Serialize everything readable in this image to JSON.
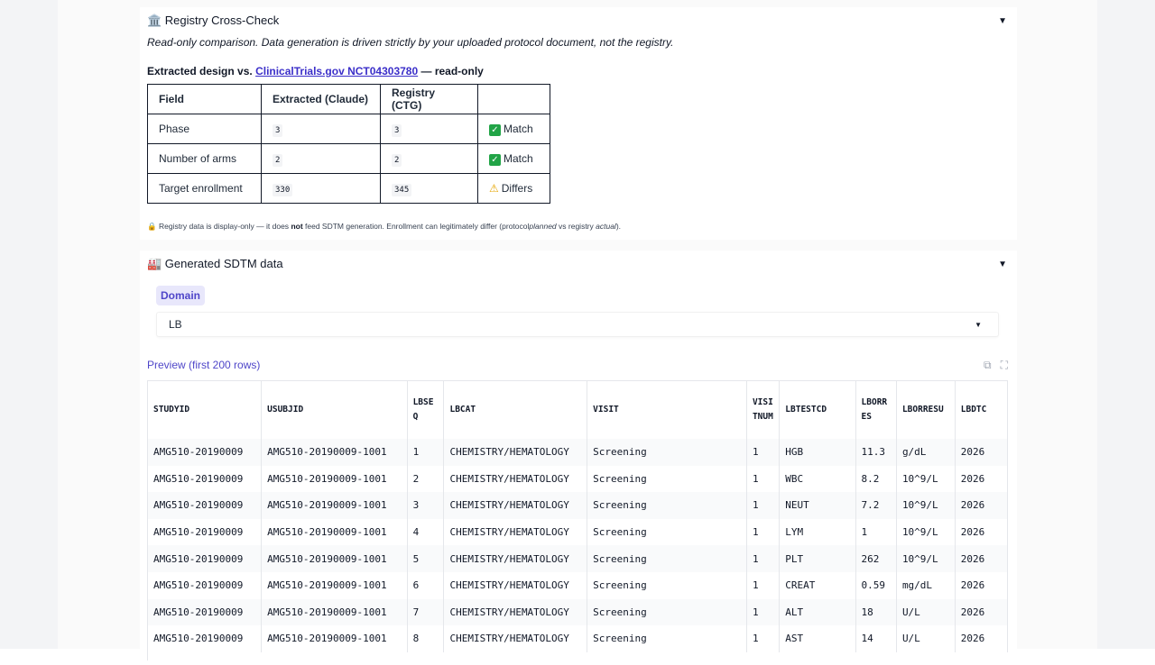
{
  "registry": {
    "icon": "classical-building-icon",
    "title": "🏛️ Registry Cross-Check",
    "note": "Read-only comparison. Data generation is driven strictly by your uploaded protocol document, not the registry.",
    "comparison_prefix": "Extracted design vs.",
    "comparison_link": "ClinicalTrials.gov NCT04303780",
    "comparison_suffix": "— read-only",
    "headers": [
      "Field",
      "Extracted (Claude)",
      "Registry (CTG)",
      ""
    ],
    "rows": [
      {
        "field": "Phase",
        "extracted": "3",
        "registry": "3",
        "status": "Match",
        "status_icon": "check-mark-icon"
      },
      {
        "field": "Number of arms",
        "extracted": "2",
        "registry": "2",
        "status": "Match",
        "status_icon": "check-mark-icon"
      },
      {
        "field": "Target enrollment",
        "extracted": "330",
        "registry": "345",
        "status": "Differs",
        "status_icon": "warning-icon"
      }
    ],
    "footnote_lock": "🔒",
    "footnote_a": "Registry data is display-only — it does",
    "footnote_not": "not",
    "footnote_b": "feed SDTM generation. Enrollment can legitimately differ (protocol",
    "footnote_planned": "planned",
    "footnote_vs": "vs registry",
    "footnote_actual": "actual",
    "footnote_end": ")."
  },
  "sdtm": {
    "title": "🏭 Generated SDTM data",
    "domain_label": "Domain",
    "domain_value": "LB",
    "preview_label": "Preview (first 200 rows)",
    "columns": [
      "STUDYID",
      "USUBJID",
      "LBSEQ",
      "LBCAT",
      "VISIT",
      "VISITNUM",
      "LBTESTCD",
      "LBORRES",
      "LBORRESU",
      "LBDTC"
    ],
    "rows": [
      [
        "AMG510-20190009",
        "AMG510-20190009-1001",
        "1",
        "CHEMISTRY/HEMATOLOGY",
        "Screening",
        "1",
        "HGB",
        "11.3",
        "g/dL",
        "2026"
      ],
      [
        "AMG510-20190009",
        "AMG510-20190009-1001",
        "2",
        "CHEMISTRY/HEMATOLOGY",
        "Screening",
        "1",
        "WBC",
        "8.2",
        "10^9/L",
        "2026"
      ],
      [
        "AMG510-20190009",
        "AMG510-20190009-1001",
        "3",
        "CHEMISTRY/HEMATOLOGY",
        "Screening",
        "1",
        "NEUT",
        "7.2",
        "10^9/L",
        "2026"
      ],
      [
        "AMG510-20190009",
        "AMG510-20190009-1001",
        "4",
        "CHEMISTRY/HEMATOLOGY",
        "Screening",
        "1",
        "LYM",
        "1",
        "10^9/L",
        "2026"
      ],
      [
        "AMG510-20190009",
        "AMG510-20190009-1001",
        "5",
        "CHEMISTRY/HEMATOLOGY",
        "Screening",
        "1",
        "PLT",
        "262",
        "10^9/L",
        "2026"
      ],
      [
        "AMG510-20190009",
        "AMG510-20190009-1001",
        "6",
        "CHEMISTRY/HEMATOLOGY",
        "Screening",
        "1",
        "CREAT",
        "0.59",
        "mg/dL",
        "2026"
      ],
      [
        "AMG510-20190009",
        "AMG510-20190009-1001",
        "7",
        "CHEMISTRY/HEMATOLOGY",
        "Screening",
        "1",
        "ALT",
        "18",
        "U/L",
        "2026"
      ],
      [
        "AMG510-20190009",
        "AMG510-20190009-1001",
        "8",
        "CHEMISTRY/HEMATOLOGY",
        "Screening",
        "1",
        "AST",
        "14",
        "U/L",
        "2026"
      ]
    ]
  }
}
